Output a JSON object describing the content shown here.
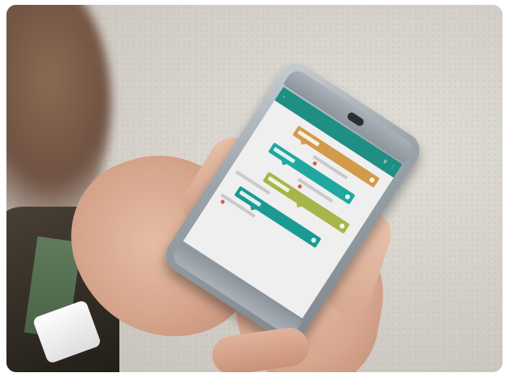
{
  "scene": {
    "description_colors": {
      "background": "#d5d1ca",
      "app_accent": "#1f8f84"
    }
  },
  "app": {
    "title": "",
    "top_bar_icons": [
      "back-arrow-icon",
      "search-icon",
      "more-icon"
    ],
    "cards": [
      {
        "color": "#d39a4b",
        "icon": "heart-icon"
      },
      {
        "color": "#20a8a0",
        "icon": "heart-icon"
      },
      {
        "color": "#a8b54a",
        "icon": "share-icon"
      },
      {
        "color": "#1a9a93",
        "icon": "heart-icon"
      }
    ]
  }
}
